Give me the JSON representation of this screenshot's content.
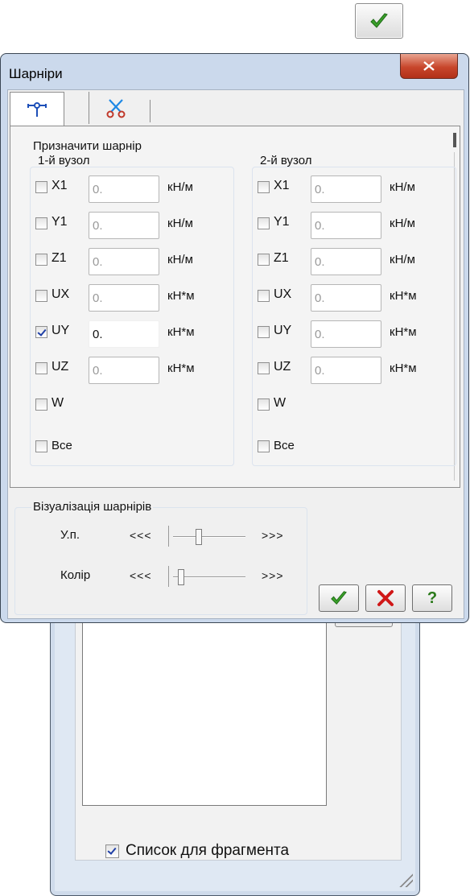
{
  "dialog": {
    "title": "Шарніри",
    "tabs": [
      {
        "icon": "hinge-icon",
        "active": true
      },
      {
        "icon": "scissors-icon",
        "active": false
      }
    ],
    "assign_group": {
      "title": "Призначити шарнір",
      "node1": {
        "title": "1-й вузол",
        "rows": [
          {
            "label": "X1",
            "checked": false,
            "value": "0.",
            "unit": "кН/м"
          },
          {
            "label": "Y1",
            "checked": false,
            "value": "0.",
            "unit": "кН/м"
          },
          {
            "label": "Z1",
            "checked": false,
            "value": "0.",
            "unit": "кН/м"
          },
          {
            "label": "UX",
            "checked": false,
            "value": "0.",
            "unit": "кН*м"
          },
          {
            "label": "UY",
            "checked": true,
            "value": "0.",
            "unit": "кН*м"
          },
          {
            "label": "UZ",
            "checked": false,
            "value": "0.",
            "unit": "кН*м"
          },
          {
            "label": "W",
            "checked": false
          }
        ],
        "all_label": "Все"
      },
      "node2": {
        "title": "2-й вузол",
        "rows": [
          {
            "label": "X1",
            "checked": false,
            "value": "0.",
            "unit": "кН/м"
          },
          {
            "label": "Y1",
            "checked": false,
            "value": "0.",
            "unit": "кН/м"
          },
          {
            "label": "Z1",
            "checked": false,
            "value": "0.",
            "unit": "кН/м"
          },
          {
            "label": "UX",
            "checked": false,
            "value": "0.",
            "unit": "кН*м"
          },
          {
            "label": "UY",
            "checked": false,
            "value": "0.",
            "unit": "кН*м"
          },
          {
            "label": "UZ",
            "checked": false,
            "value": "0.",
            "unit": "кН*м"
          },
          {
            "label": "W",
            "checked": false
          }
        ],
        "all_label": "Все"
      }
    },
    "visualization": {
      "title": "Візуалізація шарнірів",
      "size": {
        "label": "У.п.",
        "left_arrows": "<<<",
        "right_arrows": ">>>",
        "level": 0.35
      },
      "color": {
        "label": "Колір",
        "left_arrows": "<<<",
        "right_arrows": ">>>",
        "level": 0.08
      }
    },
    "buttons": {
      "apply_icon": "green-check-icon",
      "cancel_icon": "red-cross-icon",
      "help": "?"
    },
    "close_icon": "close-icon"
  },
  "background_window": {
    "list_checkbox_label": "Список для фрагмента",
    "list_checkbox_checked": true
  },
  "top_button_icon": "green-check-icon",
  "colors": {
    "accent_check": "#3aa02a",
    "cancel_red": "#d01818",
    "close_red": "#c8462c",
    "frame_blue": "#cbd9ec"
  }
}
